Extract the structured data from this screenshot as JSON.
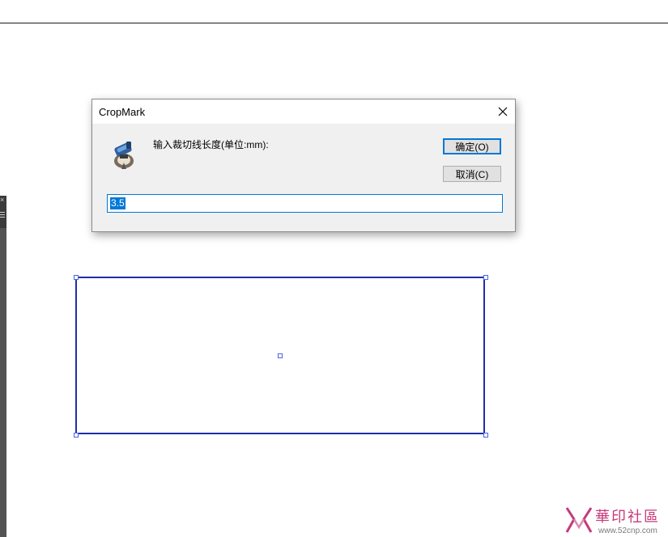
{
  "dialog": {
    "title": "CropMark",
    "prompt": "输入裁切线长度(单位:mm):",
    "ok_label": "确定(O)",
    "cancel_label": "取消(C)",
    "input_value": "3.5",
    "close_icon": "close-icon",
    "app_icon": "cropmark-app-icon"
  },
  "side_panel": {
    "close_glyph": "×",
    "menu_icon": "menu-icon"
  },
  "watermark": {
    "text": "華印社區",
    "url": "www.52cnp.com"
  },
  "colors": {
    "accent": "#0078d7",
    "selection": "#1e2ea6",
    "handle": "#4a64e6",
    "watermark": "#c63a7a"
  }
}
